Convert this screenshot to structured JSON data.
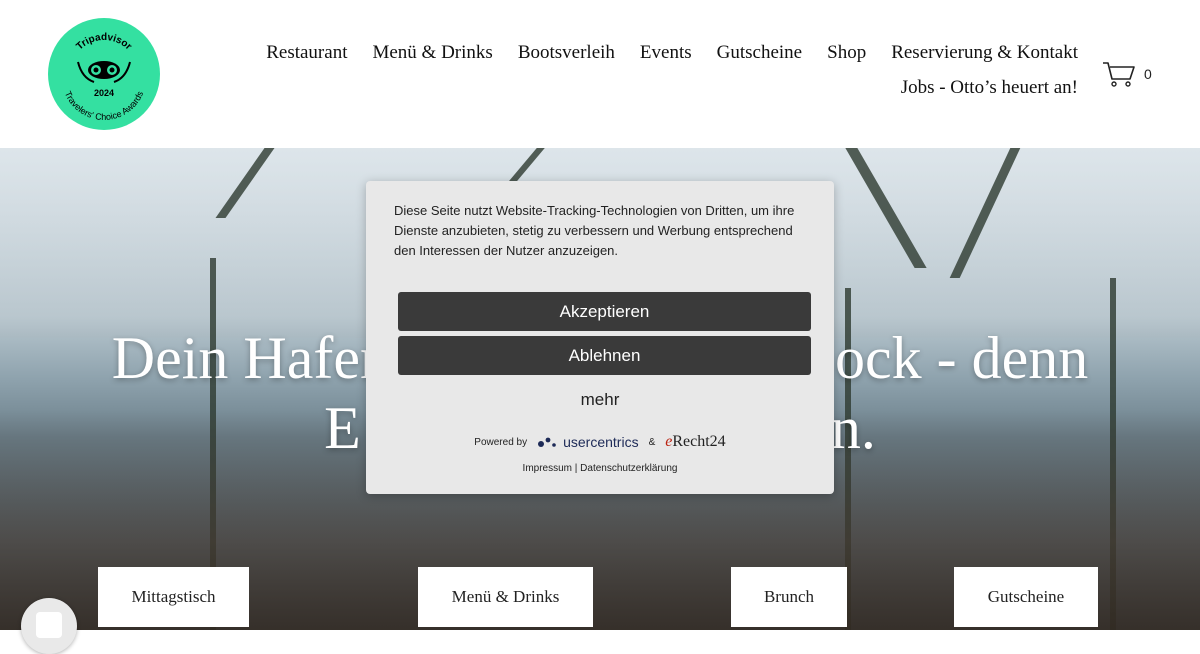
{
  "badge": {
    "brand": "Tripadvisor",
    "year": "2024",
    "award": "Travelers' Choice Awards"
  },
  "nav": {
    "row1": [
      "Restaurant",
      "Menü & Drinks",
      "Bootsverleih",
      "Events",
      "Gutscheine",
      "Shop",
      "Reservierung & Kontakt"
    ],
    "row2": [
      "Jobs - Otto’s heuert an!"
    ]
  },
  "cart": {
    "icon": "cart-icon",
    "count": "0"
  },
  "hero": {
    "line1": "Dein Hafen",
    "line1_end": "ock - denn",
    "line2": "E",
    "line2_end": "n."
  },
  "tiles": [
    "Mittagstisch",
    "Menü & Drinks",
    "Brunch",
    "Gutscheine"
  ],
  "consent": {
    "text": "Diese Seite nutzt Website-Tracking-Technologien von Dritten, um ihre Dienste anzubieten, stetig zu verbessern und Werbung entsprechend den Interessen der Nutzer anzuzeigen.",
    "accept": "Akzeptieren",
    "decline": "Ablehnen",
    "more": "mehr",
    "powered_by": "Powered by",
    "usercentrics": "usercentrics",
    "amp": "&",
    "erecht_e": "e",
    "erecht_rest": "Recht24",
    "impressum": "Impressum",
    "separator": "|",
    "privacy": "Datenschutzerklärung"
  },
  "colors": {
    "badge_green": "#34e0a1",
    "button_dark": "#3a3a3a",
    "dialog_bg": "#e8e8e8"
  }
}
